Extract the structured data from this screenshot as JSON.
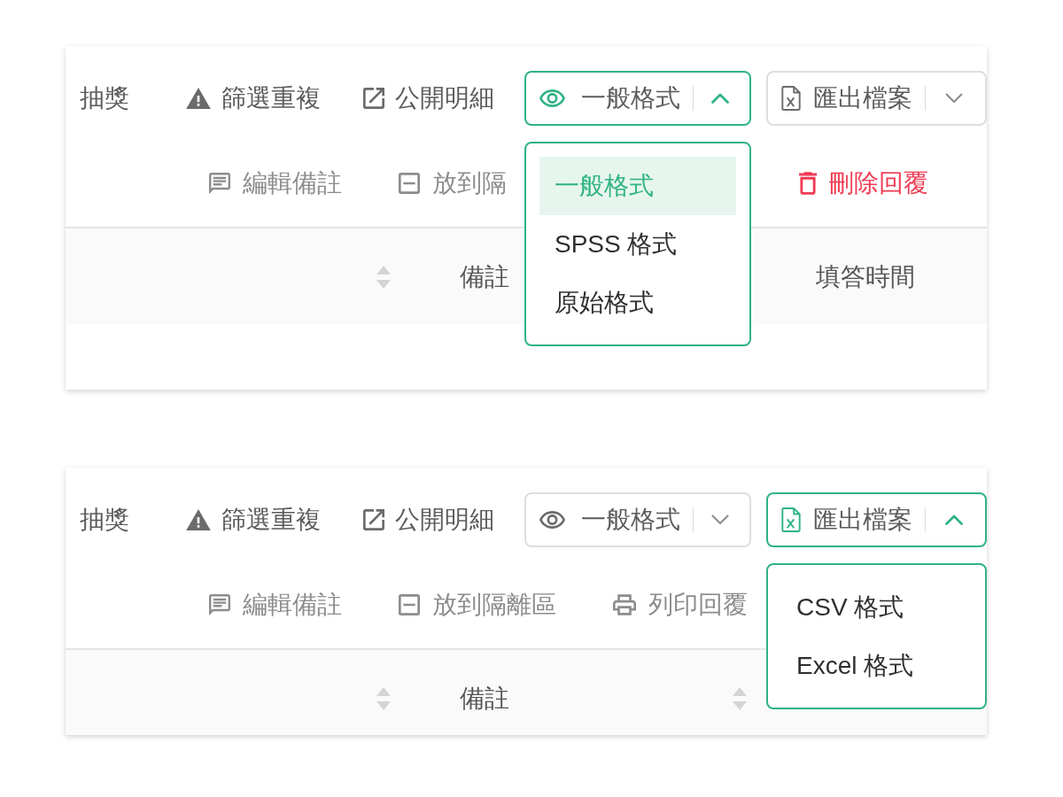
{
  "panels": [
    {
      "toolbar": {
        "label": "抽獎",
        "actions": [
          {
            "kind": "warning",
            "label": "篩選重複"
          },
          {
            "kind": "external",
            "label": "公開明細"
          }
        ],
        "format_select": {
          "value": "一般格式",
          "expanded": true,
          "options": [
            {
              "label": "一般格式",
              "selected": true
            },
            {
              "label": "SPSS 格式",
              "selected": false
            },
            {
              "label": "原始格式",
              "selected": false
            }
          ]
        },
        "export_select": {
          "label": "匯出檔案",
          "expanded": false
        }
      },
      "actions": [
        {
          "kind": "note",
          "label": "編輯備註"
        },
        {
          "kind": "quarantine",
          "label": "放到隔"
        },
        {
          "kind": "delete",
          "label": "刪除回覆"
        }
      ],
      "table": {
        "columns": [
          {
            "sort_icon": true
          },
          {
            "label": "備註",
            "sort_icon": false
          },
          {
            "label": "填答時間",
            "sort_icon": false
          }
        ]
      }
    },
    {
      "toolbar": {
        "label": "抽獎",
        "actions": [
          {
            "kind": "warning",
            "label": "篩選重複"
          },
          {
            "kind": "external",
            "label": "公開明細"
          }
        ],
        "format_select": {
          "value": "一般格式",
          "expanded": false
        },
        "export_select": {
          "label": "匯出檔案",
          "expanded": true,
          "options": [
            {
              "label": "CSV 格式"
            },
            {
              "label": "Excel 格式"
            }
          ]
        }
      },
      "actions": [
        {
          "kind": "note",
          "label": "編輯備註"
        },
        {
          "kind": "quarantine",
          "label": "放到隔離區"
        },
        {
          "kind": "print",
          "label": "列印回覆"
        }
      ],
      "table": {
        "columns": [
          {
            "sort_icon": true
          },
          {
            "label": "備註",
            "sort_icon": true
          }
        ]
      }
    }
  ]
}
